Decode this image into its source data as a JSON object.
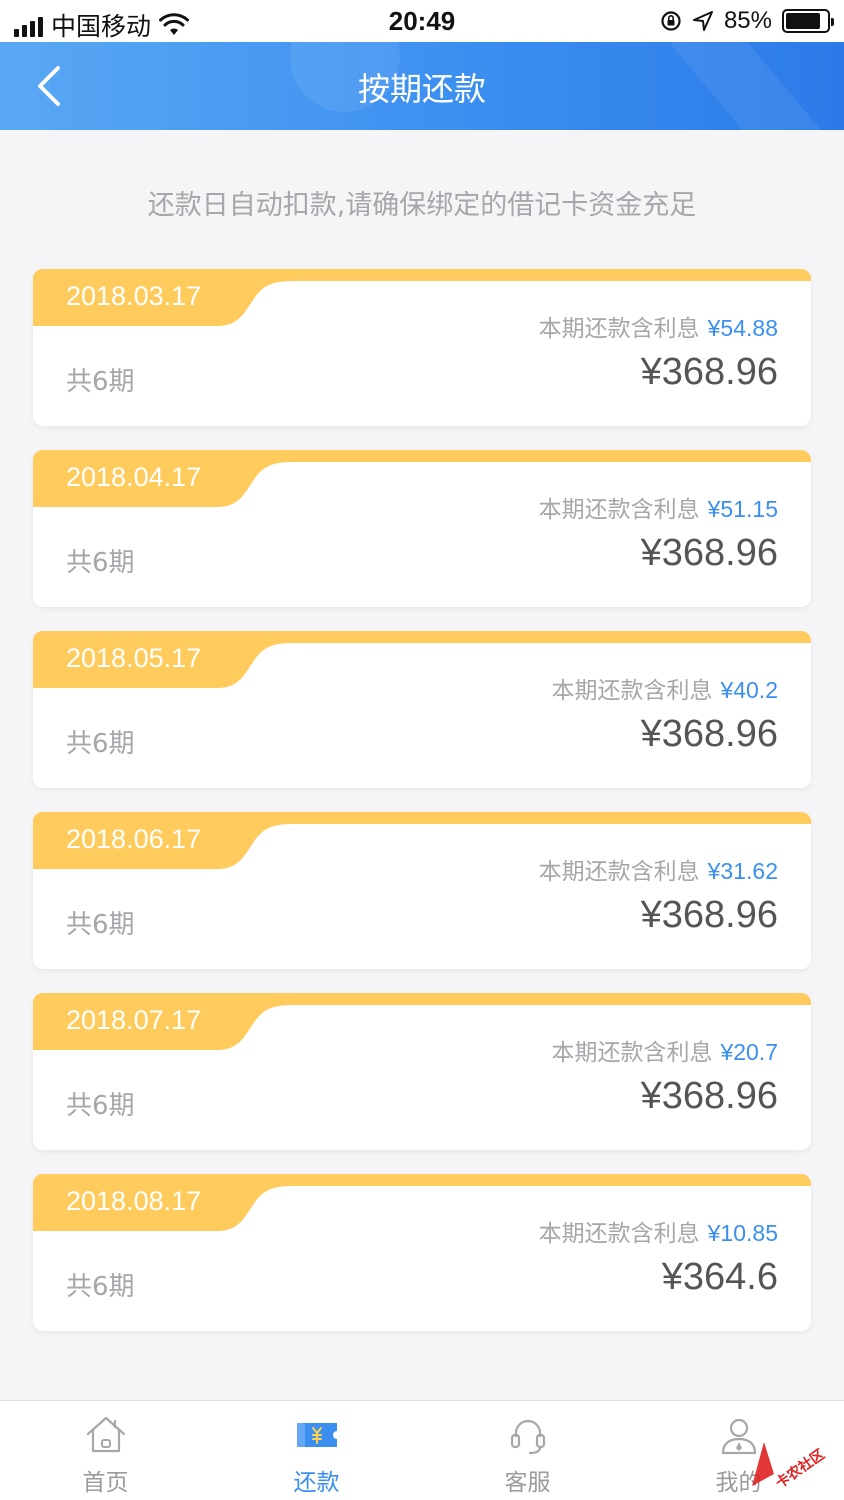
{
  "status_bar": {
    "carrier": "中国移动",
    "time": "20:49",
    "battery": "85%",
    "battery_level": 0.85
  },
  "nav": {
    "title": "按期还款"
  },
  "notice": "还款日自动扣款,请确保绑定的借记卡资金充足",
  "installments": [
    {
      "date": "2018.03.17",
      "interest_label": "本期还款含利息",
      "interest_amount": "¥54.88",
      "periods": "共6期",
      "total": "¥368.96"
    },
    {
      "date": "2018.04.17",
      "interest_label": "本期还款含利息",
      "interest_amount": "¥51.15",
      "periods": "共6期",
      "total": "¥368.96"
    },
    {
      "date": "2018.05.17",
      "interest_label": "本期还款含利息",
      "interest_amount": "¥40.2",
      "periods": "共6期",
      "total": "¥368.96"
    },
    {
      "date": "2018.06.17",
      "interest_label": "本期还款含利息",
      "interest_amount": "¥31.62",
      "periods": "共6期",
      "total": "¥368.96"
    },
    {
      "date": "2018.07.17",
      "interest_label": "本期还款含利息",
      "interest_amount": "¥20.7",
      "periods": "共6期",
      "total": "¥368.96"
    },
    {
      "date": "2018.08.17",
      "interest_label": "本期还款含利息",
      "interest_amount": "¥10.85",
      "periods": "共6期",
      "total": "¥364.6"
    }
  ],
  "tab_bar": {
    "items": [
      {
        "label": "首页",
        "icon": "home-icon",
        "active": false
      },
      {
        "label": "还款",
        "icon": "repay-ticket-icon",
        "active": true
      },
      {
        "label": "客服",
        "icon": "headset-icon",
        "active": false
      },
      {
        "label": "我的",
        "icon": "user-icon",
        "active": false
      }
    ]
  },
  "colors": {
    "accent_blue": "#3b8ff0",
    "card_yellow": "#ffcb5c",
    "muted_text": "#a6a6ab"
  }
}
